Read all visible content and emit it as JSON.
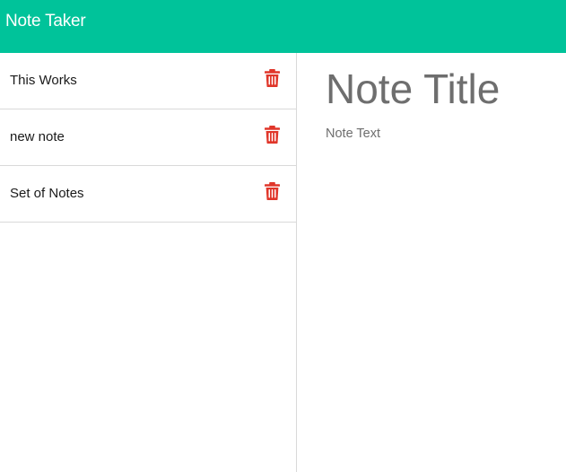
{
  "header": {
    "brand": "Note Taker"
  },
  "sidebar": {
    "notes": [
      {
        "title": "This Works",
        "delete_icon": "trash-icon"
      },
      {
        "title": "new note",
        "delete_icon": "trash-icon"
      },
      {
        "title": "Set of Notes",
        "delete_icon": "trash-icon"
      }
    ]
  },
  "editor": {
    "title_placeholder": "Note Title",
    "text_placeholder": "Note Text"
  },
  "colors": {
    "navbar": "#00c39a",
    "delete_icon": "#e0362a",
    "placeholder_text": "#6e6e6e"
  }
}
